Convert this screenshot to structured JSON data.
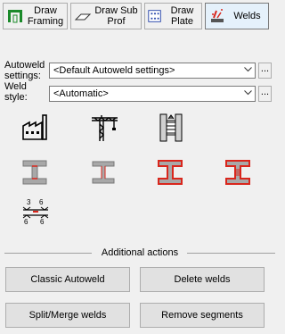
{
  "toolbar": {
    "draw_framing": "Draw\nFraming",
    "draw_sub_prof": "Draw Sub\nProf",
    "draw_plate": "Draw Plate",
    "welds": "Welds"
  },
  "autoweld": {
    "label": "Autoweld settings:",
    "value": "<Default Autoweld settings>",
    "dots": "..."
  },
  "weldstyle": {
    "label": "Weld style:",
    "value": "<Automatic>",
    "dots": "..."
  },
  "icons": {
    "row1": [
      "factory-icon",
      "crane-icon",
      "weld-joint-icon"
    ],
    "row2": [
      "ibeam-gray-icon",
      "ibeam-gray-small-icon",
      "ibeam-red-outline-icon",
      "ibeam-red-outline-rotated-icon"
    ],
    "row3": [
      "weld-symbol-icon"
    ]
  },
  "weld_symbol": {
    "top_left": "3",
    "top_right": "6",
    "bottom_left": "6",
    "bottom_right": "6"
  },
  "additional": {
    "title": "Additional actions",
    "classic_autoweld": "Classic Autoweld",
    "delete_welds": "Delete welds",
    "split_merge": "Split/Merge welds",
    "remove_segments": "Remove segments"
  },
  "colors": {
    "accent_red": "#d9261c",
    "toolbar_active": "#e5f1fb"
  }
}
